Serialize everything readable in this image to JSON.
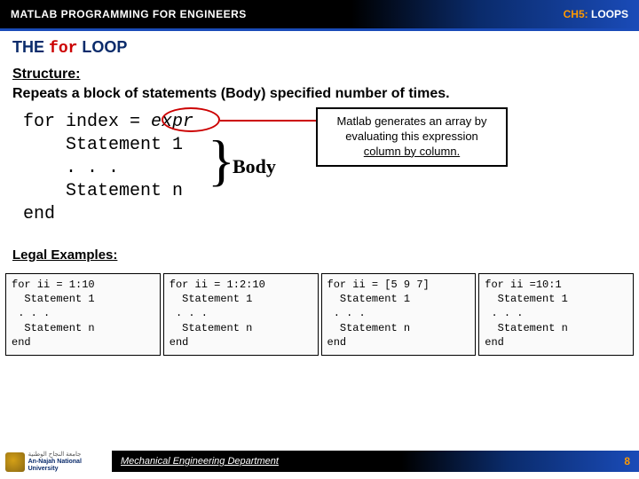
{
  "header": {
    "left": "MATLAB PROGRAMMING FOR ENGINEERS",
    "chapter": "CH5:",
    "topic": " LOOPS"
  },
  "title": {
    "the": "THE ",
    "for": "for",
    "loop": " LOOP"
  },
  "structure": {
    "heading": "Structure:",
    "desc": "Repeats a block of statements (Body) specified number of times.",
    "code": {
      "l1a": "for index = ",
      "l1b": "expr",
      "l2": "    Statement 1",
      "l3": "    . . .",
      "l4": "    Statement n",
      "l5": "end"
    },
    "body_label": "Body",
    "callout": {
      "l1": "Matlab generates an array by",
      "l2": "evaluating this expression",
      "l3": "column by column."
    }
  },
  "legal": {
    "heading": "Legal Examples:",
    "examples": [
      {
        "l1": "for ii = 1:10",
        "l2": "  Statement 1",
        "l3": " . . .",
        "l4": "  Statement n",
        "l5": "end"
      },
      {
        "l1": "for ii = 1:2:10",
        "l2": "  Statement 1",
        "l3": " . . .",
        "l4": "  Statement n",
        "l5": "end"
      },
      {
        "l1": "for ii = [5 9 7]",
        "l2": "  Statement 1",
        "l3": " . . .",
        "l4": "  Statement n",
        "l5": "end"
      },
      {
        "l1": "for ii =10:1",
        "l2": "  Statement 1",
        "l3": " . . .",
        "l4": "  Statement n",
        "l5": "end"
      }
    ]
  },
  "footer": {
    "uni_ar": "جامعة النجاح الوطنية",
    "uni_en": "An-Najah National University",
    "dept": "Mechanical Engineering Department",
    "page": "8"
  }
}
